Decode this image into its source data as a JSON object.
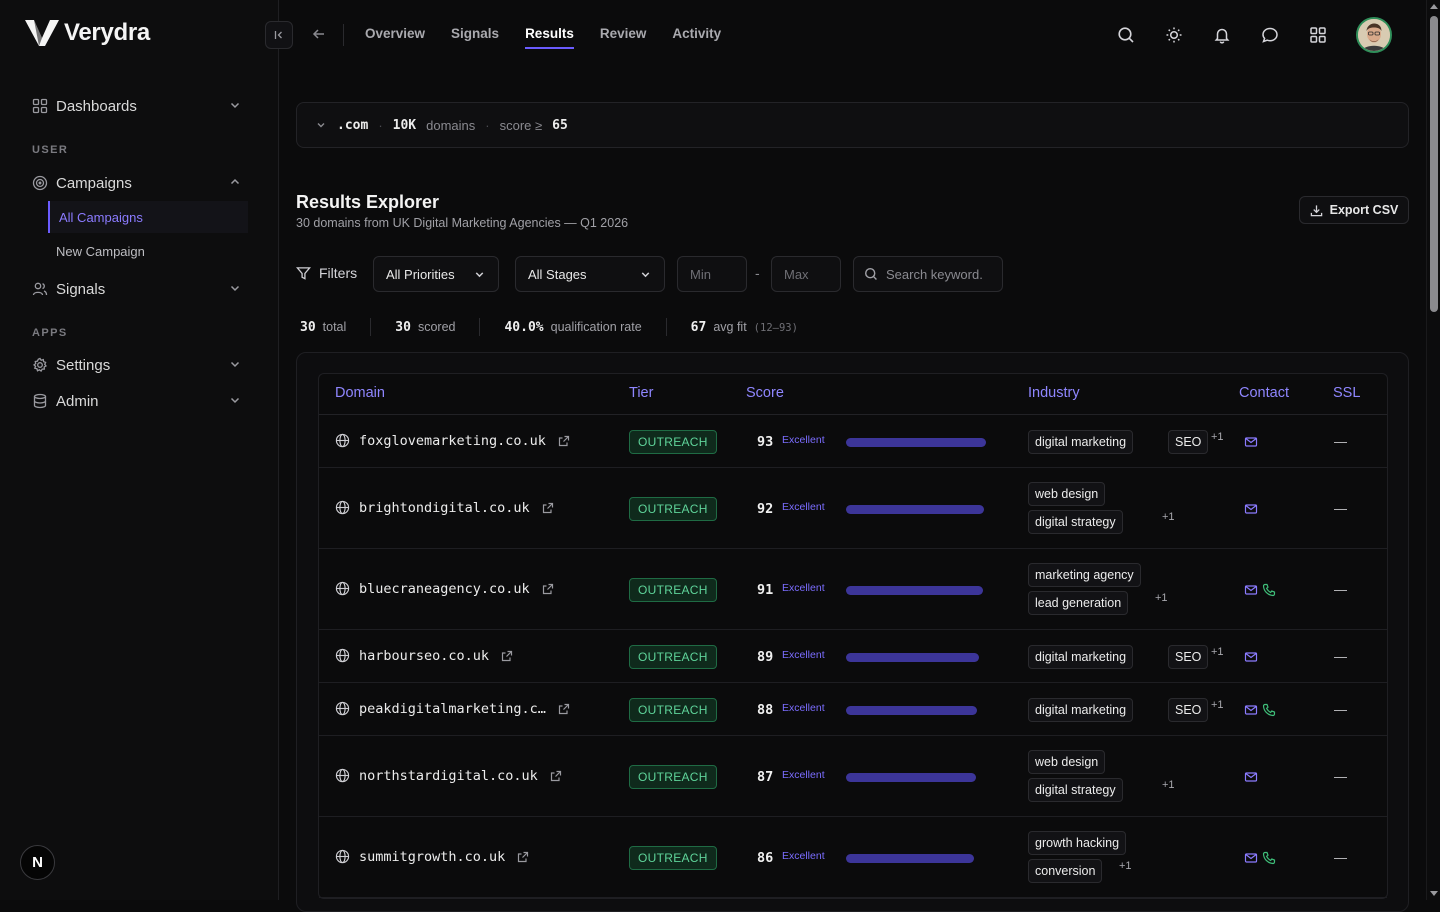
{
  "app": {
    "name": "Verydra"
  },
  "sidebar": {
    "dashboards": "Dashboards",
    "user_section": "USER",
    "campaigns": "Campaigns",
    "all_campaigns": "All Campaigns",
    "new_campaign": "New Campaign",
    "signals": "Signals",
    "apps_section": "APPS",
    "settings": "Settings",
    "admin": "Admin",
    "bottom_badge": "N"
  },
  "topbar": {
    "tabs": [
      "Overview",
      "Signals",
      "Results",
      "Review",
      "Activity"
    ],
    "active_tab": "Results"
  },
  "query": {
    "tld": ".com",
    "domains_count": "10K",
    "domains_label": "domains",
    "score_label": "score ≥",
    "score_value": "65"
  },
  "page": {
    "title": "Results Explorer",
    "subtitle": "30 domains from UK Digital Marketing Agencies — Q1 2026",
    "export_label": "Export CSV"
  },
  "filters": {
    "label": "Filters",
    "priority": "All Priorities",
    "stage": "All Stages",
    "min_placeholder": "Min",
    "range_sep": "-",
    "max_placeholder": "Max",
    "search_placeholder": "Search keyword."
  },
  "stats": {
    "total_value": "30",
    "total_label": "total",
    "scored_value": "30",
    "scored_label": "scored",
    "qual_value": "40.0%",
    "qual_label": "qualification rate",
    "fit_value": "67",
    "fit_label": "avg fit",
    "fit_range": "(12–93)"
  },
  "table": {
    "columns": [
      "Domain",
      "Tier",
      "Score",
      "Industry",
      "Contact",
      "SSL"
    ],
    "rows": [
      {
        "domain": "foxglovemarketing.co.uk",
        "tier": "OUTREACH",
        "score": "93",
        "score_label": "Excellent",
        "score_fraction": 0.93,
        "tags": [
          "digital marketing",
          "SEO"
        ],
        "more": "+1",
        "contact": [
          "email"
        ],
        "ssl": "—",
        "layout": "inline"
      },
      {
        "domain": "brightondigital.co.uk",
        "tier": "OUTREACH",
        "score": "92",
        "score_label": "Excellent",
        "score_fraction": 0.92,
        "tags": [
          "web design",
          "digital strategy"
        ],
        "more": "+1",
        "contact": [
          "email"
        ],
        "ssl": "—",
        "layout": "stack"
      },
      {
        "domain": "bluecraneagency.co.uk",
        "tier": "OUTREACH",
        "score": "91",
        "score_label": "Excellent",
        "score_fraction": 0.91,
        "tags": [
          "marketing agency",
          "lead generation"
        ],
        "more": "+1",
        "contact": [
          "email",
          "phone"
        ],
        "ssl": "—",
        "layout": "stack"
      },
      {
        "domain": "harbourseo.co.uk",
        "tier": "OUTREACH",
        "score": "89",
        "score_label": "Excellent",
        "score_fraction": 0.89,
        "tags": [
          "digital marketing",
          "SEO"
        ],
        "more": "+1",
        "contact": [
          "email"
        ],
        "ssl": "—",
        "layout": "inline"
      },
      {
        "domain": "peakdigitalmarketing.c…",
        "tier": "OUTREACH",
        "score": "88",
        "score_label": "Excellent",
        "score_fraction": 0.88,
        "tags": [
          "digital marketing",
          "SEO"
        ],
        "more": "+1",
        "contact": [
          "email",
          "phone"
        ],
        "ssl": "—",
        "layout": "inline"
      },
      {
        "domain": "northstardigital.co.uk",
        "tier": "OUTREACH",
        "score": "87",
        "score_label": "Excellent",
        "score_fraction": 0.87,
        "tags": [
          "web design",
          "digital strategy"
        ],
        "more": "+1",
        "contact": [
          "email"
        ],
        "ssl": "—",
        "layout": "stack"
      },
      {
        "domain": "summitgrowth.co.uk",
        "tier": "OUTREACH",
        "score": "86",
        "score_label": "Excellent",
        "score_fraction": 0.86,
        "tags": [
          "growth hacking",
          "conversion"
        ],
        "more": "+1",
        "contact": [
          "email",
          "phone"
        ],
        "ssl": "—",
        "layout": "stack"
      }
    ]
  },
  "colors": {
    "accent": "#6b5cff",
    "score_bar": "#3c3599",
    "tier_green": "#5fd49a",
    "email_icon": "#8b7bff",
    "phone_icon": "#3fbf7a"
  }
}
